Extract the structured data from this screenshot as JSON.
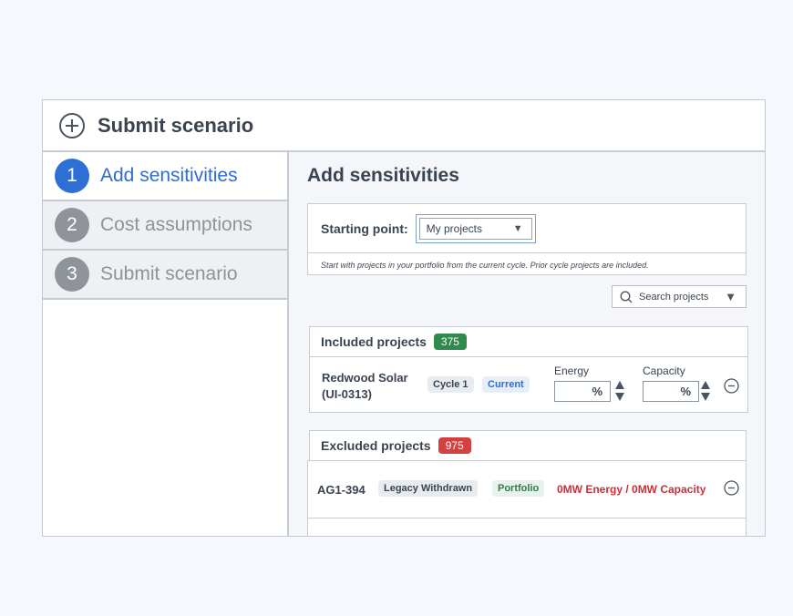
{
  "header": {
    "title": "Submit scenario",
    "icon": "plus-circle-icon"
  },
  "steps": [
    {
      "number": "1",
      "label": "Add sensitivities"
    },
    {
      "number": "2",
      "label": "Cost assumptions"
    },
    {
      "number": "3",
      "label": "Submit scenario"
    }
  ],
  "main": {
    "title": "Add sensitivities",
    "starting_point_label": "Starting point:",
    "starting_point_value": "My projects",
    "note": "Start with projects in your portfolio from the current cycle. Prior cycle projects are included.",
    "search_placeholder": "Search projects"
  },
  "included": {
    "title": "Included projects",
    "count": "375",
    "project": {
      "name_line1": "Redwood Solar",
      "name_line2": "(UI-0313)",
      "tag1": "Cycle 1",
      "tag2": "Current",
      "energy_label": "Energy",
      "energy_unit": "%",
      "capacity_label": "Capacity",
      "capacity_unit": "%"
    }
  },
  "excluded": {
    "title": "Excluded projects",
    "count": "975",
    "project": {
      "name": "AG1-394",
      "tag1": "Legacy Withdrawn",
      "tag2": "Portfolio",
      "summary": "0MW Energy / 0MW Capacity"
    }
  },
  "colors": {
    "accent": "#2e6fd6",
    "included_badge": "#2e8a4d",
    "excluded_badge": "#d2413f",
    "summary_red": "#c8313a"
  }
}
